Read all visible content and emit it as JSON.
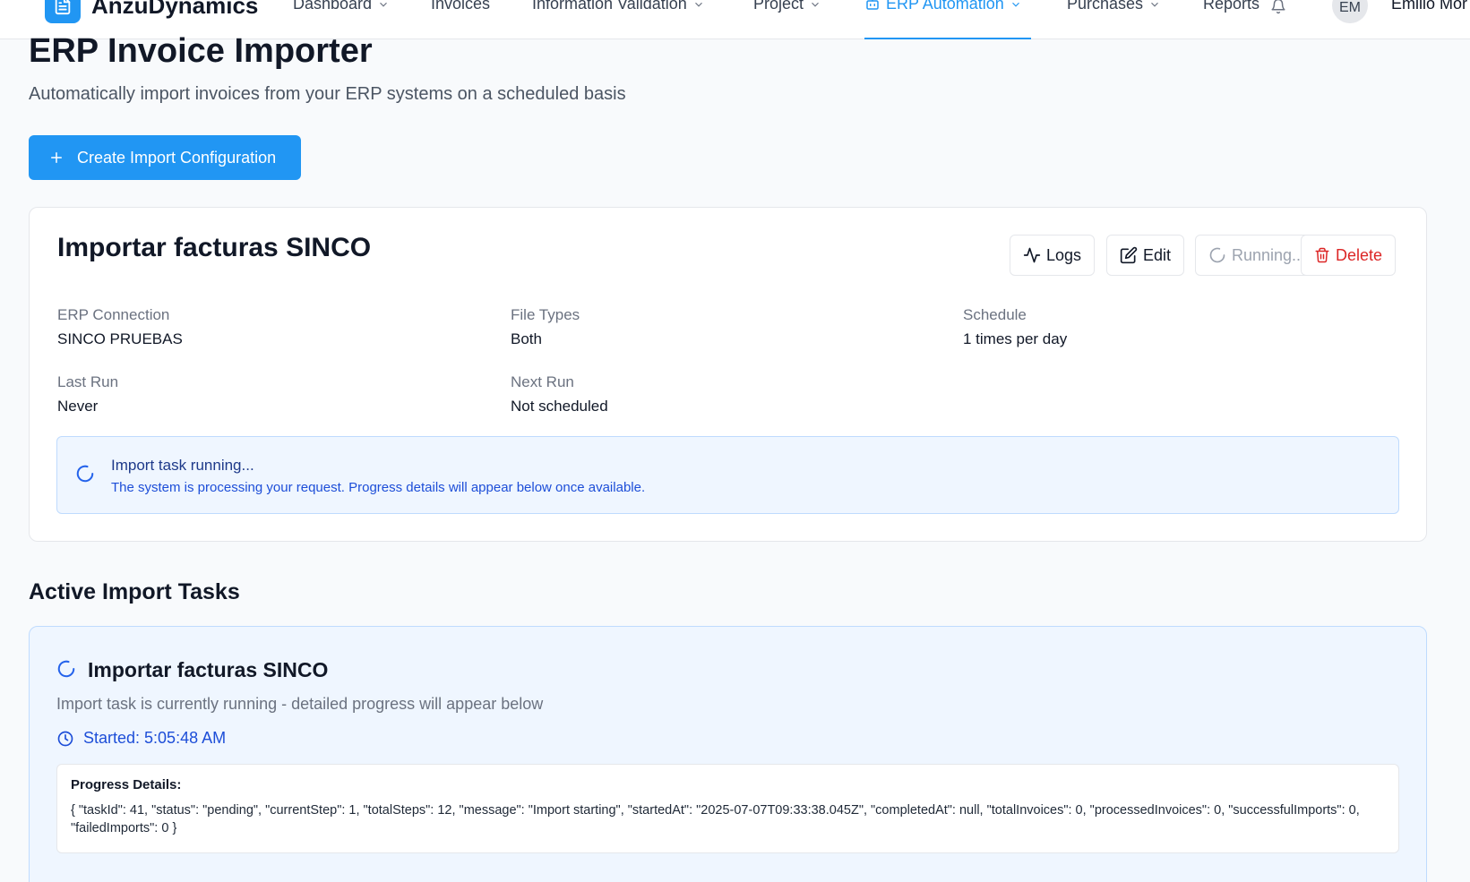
{
  "brand": {
    "name": "AnzuDynamics",
    "logo_icon": "document-icon",
    "accent_color": "#2196f3"
  },
  "nav": {
    "items": [
      {
        "label": "Dashboard",
        "has_dropdown": true
      },
      {
        "label": "Invoices",
        "has_dropdown": false
      },
      {
        "label": "Information Validation",
        "has_dropdown": true
      },
      {
        "label": "Project",
        "has_dropdown": true
      },
      {
        "label": "ERP Automation",
        "has_dropdown": true,
        "active": true,
        "icon": "bot-icon"
      },
      {
        "label": "Purchases",
        "has_dropdown": true
      },
      {
        "label": "Reports",
        "has_dropdown": false
      }
    ],
    "notification_icon": "bell-icon",
    "user": {
      "initials": "EM",
      "name": "Emilio Mor"
    }
  },
  "page": {
    "title": "ERP Invoice Importer",
    "subtitle": "Automatically import invoices from your ERP systems on a scheduled basis",
    "create_button": "Create Import Configuration"
  },
  "config_card": {
    "title": "Importar facturas SINCO",
    "buttons": {
      "logs": "Logs",
      "edit": "Edit",
      "running": "Running...",
      "delete": "Delete"
    },
    "fields": {
      "erp_connection": {
        "label": "ERP Connection",
        "value": "SINCO PRUEBAS"
      },
      "file_types": {
        "label": "File Types",
        "value": "Both"
      },
      "schedule": {
        "label": "Schedule",
        "value": "1 times per day"
      },
      "last_run": {
        "label": "Last Run",
        "value": "Never"
      },
      "next_run": {
        "label": "Next Run",
        "value": "Not scheduled"
      }
    },
    "alert": {
      "title": "Import task running...",
      "text": "The system is processing your request. Progress details will appear below once available."
    }
  },
  "active_tasks": {
    "section_title": "Active Import Tasks",
    "task": {
      "title": "Importar facturas SINCO",
      "description": "Import task is currently running - detailed progress will appear below",
      "started": "Started: 5:05:48 AM",
      "progress_label": "Progress Details:",
      "progress_json": "{ \"taskId\": 41, \"status\": \"pending\", \"currentStep\": 1, \"totalSteps\": 12, \"message\": \"Import starting\", \"startedAt\": \"2025-07-07T09:33:38.045Z\", \"completedAt\": null, \"totalInvoices\": 0, \"processedInvoices\": 0, \"successfulImports\": 0, \"failedImports\": 0 }"
    }
  }
}
